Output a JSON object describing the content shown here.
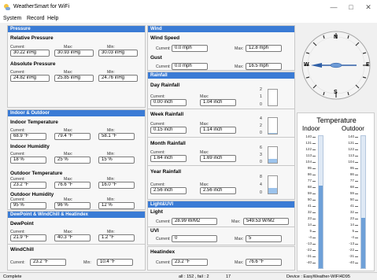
{
  "window": {
    "title": "WeatherSmart for WiFi",
    "controls": [
      "—",
      "□",
      "✕"
    ]
  },
  "menu": [
    "System",
    "Record",
    "Help"
  ],
  "labels": {
    "current": "Current:",
    "max": "Max:",
    "min": "Min:"
  },
  "pressure": {
    "header": "Pressure",
    "relative": {
      "title": "Relative Pressure",
      "current": "30.22 inHg",
      "max": "30.93 inHg",
      "min": "30.03 inHg"
    },
    "absolute": {
      "title": "Absolute Pressure",
      "current": "24.82 inHg",
      "max": "25.85 inHg",
      "min": "24.76 inHg"
    }
  },
  "indoor_outdoor": {
    "header": "Indoor & Outdoor",
    "indoor_temp": {
      "title": "Indoor Temperature",
      "current": "68.9 °F",
      "max": "79.4 °F",
      "min": "58.1 °F"
    },
    "indoor_hum": {
      "title": "Indoor Humidity",
      "current": "18 %",
      "max": "25 %",
      "min": "15 %"
    },
    "outdoor_temp": {
      "title": "Outdoor Temperature",
      "current": "23.2 °F",
      "max": "76.6 °F",
      "min": "16.0 °F"
    },
    "outdoor_hum": {
      "title": "Outdoor Humidity",
      "current": "95 %",
      "max": "96 %",
      "min": "12 %"
    }
  },
  "dewpoint": {
    "header": "DewPoint & WindChill & Heatindex",
    "dew": {
      "title": "DewPoint",
      "current": "21.9 °F",
      "max": "40.3 °F",
      "min": "1.2 °F"
    },
    "chill": {
      "title": "WindChill",
      "current_label": "Current:",
      "current": "23.2 °F",
      "min_label": "Min:",
      "min": "10.4 °F"
    }
  },
  "wind": {
    "header": "Wind",
    "speed": {
      "title": "Wind Speed",
      "current_label": "Current:",
      "current": "0.0 mph",
      "max_label": "Max:",
      "max": "12.8 mph"
    },
    "gust": {
      "title": "Gust",
      "current_label": "Current:",
      "current": "0.0 mph",
      "max_label": "Max:",
      "max": "16.5 mph"
    }
  },
  "rainfall": {
    "header": "Rainfall",
    "day": {
      "title": "Day Rainfall",
      "current": "0.00 inch",
      "max": "1.04 inch",
      "scale": [
        "2",
        "1",
        "0"
      ],
      "level": 0
    },
    "week": {
      "title": "Week Rainfall",
      "current": "0.15 inch",
      "max": "1.14 inch",
      "scale": [
        "4",
        "2",
        "0"
      ],
      "level": 0.04
    },
    "month": {
      "title": "Month Rainfall",
      "current": "1.64 inch",
      "max": "1.69 inch",
      "scale": [
        "6",
        "3",
        "0"
      ],
      "level": 0.27
    },
    "year": {
      "title": "Year Rainfall",
      "current": "2.56 inch",
      "max": "2.56 inch",
      "scale": [
        "8",
        "4",
        "0"
      ],
      "level": 0.32
    }
  },
  "lightuv": {
    "header": "Light&UVI",
    "light": {
      "title": "Light",
      "current_label": "Current:",
      "current": "28.99 W/M2",
      "max_label": "Max:",
      "max": "549.53 W/M2"
    },
    "uvi": {
      "title": "UVI",
      "current_label": "Current:",
      "current": "0",
      "max_label": "Max:",
      "max": "5"
    }
  },
  "heatindex": {
    "title": "Heatindex",
    "current_label": "Current:",
    "current": "23.2 °F",
    "max_label": "Max:",
    "max": "76.6 °F"
  },
  "compass": {
    "n": "N",
    "s": "S",
    "e": "E",
    "w": "W"
  },
  "temperature_panel": {
    "title": "Temperature",
    "indoor_label": "Indoor",
    "outdoor_label": "Outdoor",
    "scale": [
      "140",
      "131",
      "122",
      "113",
      "104",
      "95",
      "86",
      "77",
      "68",
      "59",
      "50",
      "41",
      "32",
      "23",
      "14",
      "5",
      "-4",
      "-13",
      "-22",
      "-31",
      "-40"
    ],
    "indoor_value": 68.9,
    "outdoor_value": 23.2
  },
  "status": {
    "left": "Complete",
    "middle": "all : 152 , fail : 2",
    "count": "17",
    "right": "Device : EasyWeather-WIFI4D95"
  }
}
